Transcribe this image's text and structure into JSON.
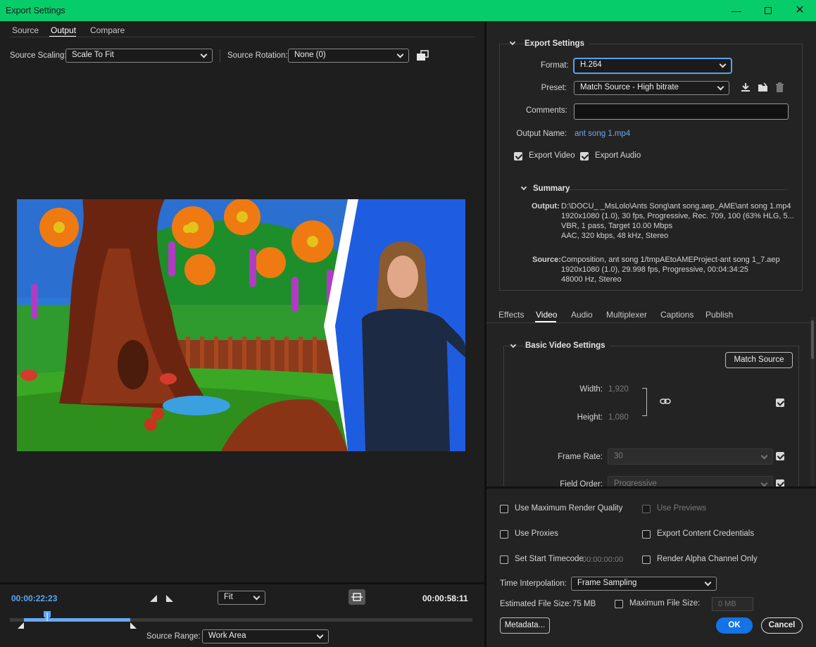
{
  "window": {
    "title": "Export Settings"
  },
  "left_tabs": [
    "Source",
    "Output",
    "Compare"
  ],
  "scaling": {
    "label": "Source Scaling:",
    "value": "Scale To Fit",
    "rotation_label": "Source Rotation:",
    "rotation_value": "None (0)"
  },
  "timeline": {
    "current": "00:00:22:23",
    "zoom": "Fit",
    "duration": "00:00:58:11",
    "range_label": "Source Range:",
    "range_value": "Work Area",
    "playhead_fraction": 0.08,
    "in_fraction": 0.03,
    "out_fraction": 0.26
  },
  "export_settings": {
    "header": "Export Settings",
    "format_label": "Format:",
    "format_value": "H.264",
    "preset_label": "Preset:",
    "preset_value": "Match Source - High bitrate",
    "comments_label": "Comments:",
    "comments_value": "",
    "output_name_label": "Output Name:",
    "output_name_value": "ant song 1.mp4",
    "export_video": "Export Video",
    "export_audio": "Export Audio"
  },
  "summary": {
    "header": "Summary",
    "output_label": "Output:",
    "output_lines": [
      "D:\\DOCU_ _MsLolo\\Ants Song\\ant song.aep_AME\\ant song 1.mp4",
      "1920x1080 (1.0), 30 fps, Progressive, Rec. 709, 100 (63% HLG, 5...",
      "VBR, 1 pass, Target 10.00 Mbps",
      "AAC, 320 kbps, 48 kHz, Stereo"
    ],
    "source_label": "Source:",
    "source_lines": [
      "Composition, ant song 1/tmpAEtoAMEProject-ant song 1_7.aep",
      "1920x1080 (1.0), 29.998 fps, Progressive, 00:04:34:25",
      "48000 Hz, Stereo"
    ]
  },
  "settings_tabs": [
    "Effects",
    "Video",
    "Audio",
    "Multiplexer",
    "Captions",
    "Publish"
  ],
  "video": {
    "header": "Basic Video Settings",
    "match_source": "Match Source",
    "width_label": "Width:",
    "width_value": "1,920",
    "height_label": "Height:",
    "height_value": "1,080",
    "frame_rate_label": "Frame Rate:",
    "frame_rate_value": "30",
    "field_order_label": "Field Order:",
    "field_order_value": "Progressive"
  },
  "bottom": {
    "max_render": "Use Maximum Render Quality",
    "use_previews": "Use Previews",
    "use_proxies": "Use Proxies",
    "content_credentials": "Export Content Credentials",
    "set_start_tc": "Set Start Timecode",
    "start_tc_value": "00:00:00:00",
    "alpha_only": "Render Alpha Channel Only",
    "time_interp_label": "Time Interpolation:",
    "time_interp_value": "Frame Sampling",
    "est_size_label": "Estimated File Size:",
    "est_size_value": "75 MB",
    "max_size_label": "Maximum File Size:",
    "max_size_value": "0 MB",
    "metadata": "Metadata...",
    "ok": "OK",
    "cancel": "Cancel"
  },
  "colors": {
    "title_bar": "#07cc6a",
    "accent": "#1473e6",
    "link": "#6aa8f0"
  }
}
